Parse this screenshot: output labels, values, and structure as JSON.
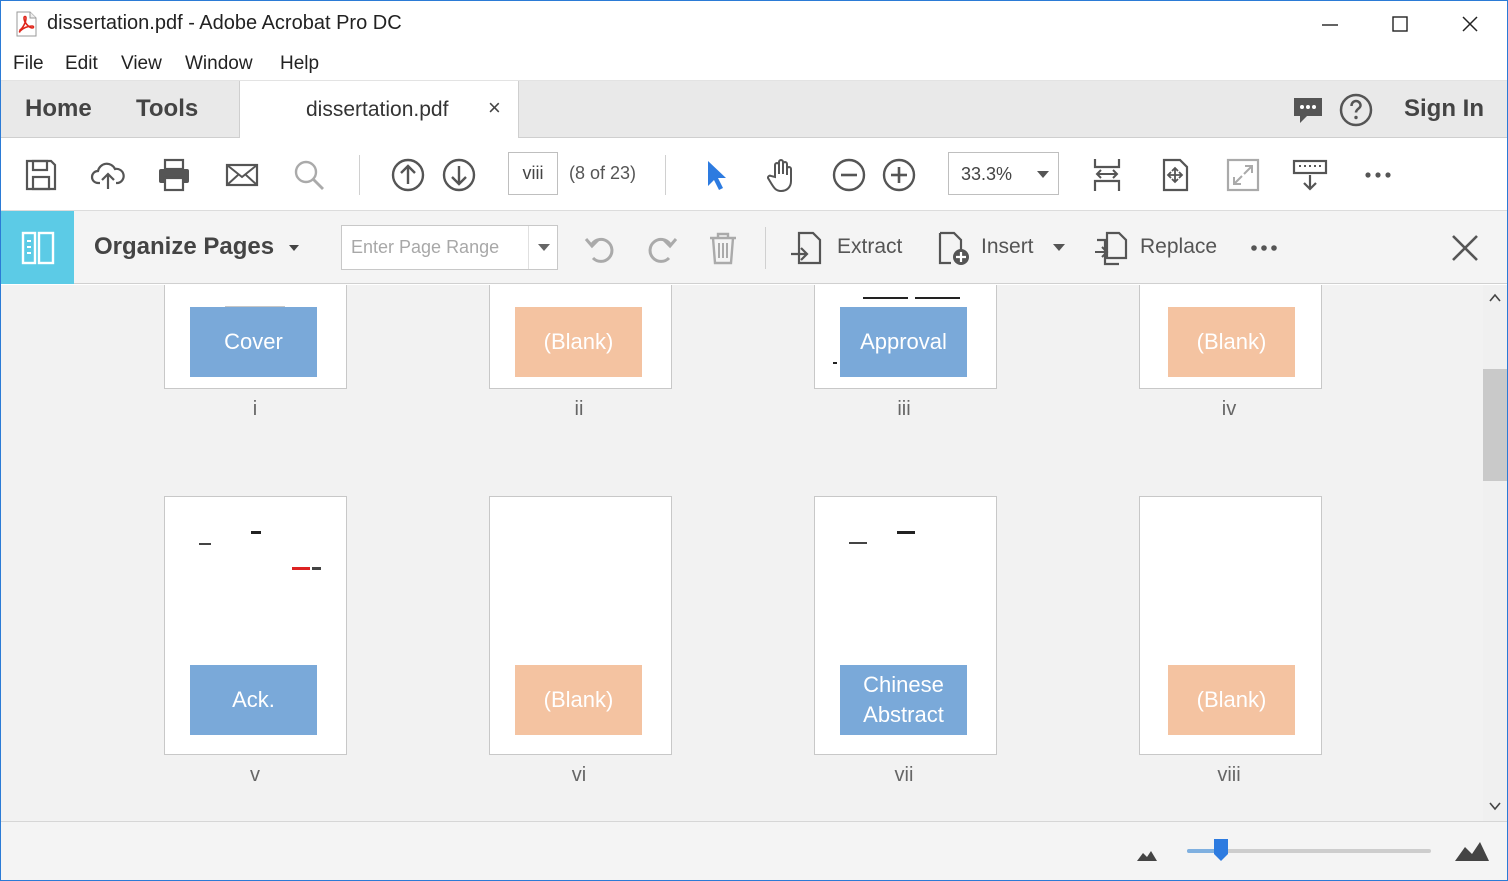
{
  "window": {
    "title": "dissertation.pdf - Adobe Acrobat Pro DC"
  },
  "menu": [
    "File",
    "Edit",
    "View",
    "Window",
    "Help"
  ],
  "tabs": {
    "home": "Home",
    "tools": "Tools",
    "document": "dissertation.pdf",
    "close": "×",
    "sign_in": "Sign In"
  },
  "toolbar": {
    "page_value": "viii",
    "page_count": "(8 of 23)",
    "zoom": "33.3%"
  },
  "organize": {
    "title": "Organize Pages",
    "range_placeholder": "Enter Page Range",
    "extract": "Extract",
    "insert": "Insert",
    "replace": "Replace"
  },
  "pages": [
    {
      "label": "Cover",
      "number": "i",
      "type": "section"
    },
    {
      "label": "(Blank)",
      "number": "ii",
      "type": "blank"
    },
    {
      "label": "Approval",
      "number": "iii",
      "type": "section"
    },
    {
      "label": "(Blank)",
      "number": "iv",
      "type": "blank"
    },
    {
      "label": "Ack.",
      "number": "v",
      "type": "section"
    },
    {
      "label": "(Blank)",
      "number": "vi",
      "type": "blank"
    },
    {
      "label": "Chinese Abstract",
      "number": "vii",
      "type": "section"
    },
    {
      "label": "(Blank)",
      "number": "viii",
      "type": "blank"
    }
  ],
  "thumbnail_size": {
    "value": 0.14
  },
  "colors": {
    "accent": "#5ccbe6",
    "section_label": "#7aa9d9",
    "blank_label": "#f4c3a1",
    "window_border": "#2b7bd6",
    "select_tool": "#2d7be0"
  }
}
